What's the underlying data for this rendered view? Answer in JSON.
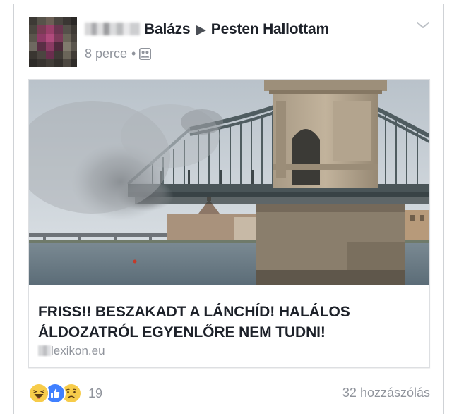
{
  "post": {
    "author_first_name": "Balázs",
    "author_last_name_blurred": "",
    "target_group": "Pesten Hallottam",
    "timestamp": "8 perce",
    "separator": "•",
    "audience_icon": "group-icon",
    "menu_icon": "chevron-down-icon"
  },
  "link_card": {
    "title": "FRISS!! BESZAKADT A LÁNCHÍD! HALÁLOS ÁLDOZATRÓL EGYENLŐRE NEM TUDNI!",
    "source_domain": "lexikon.eu"
  },
  "footer": {
    "reactions": [
      "haha-icon",
      "like-icon",
      "sad-icon"
    ],
    "reaction_count": "19",
    "comment_count": "32 hozzászólás"
  },
  "colors": {
    "text_primary": "#1d2129",
    "text_secondary": "#90949c",
    "like_blue": "#4080ff",
    "emoji_yellow": "#f7cc4a",
    "border": "#dddfe2"
  }
}
